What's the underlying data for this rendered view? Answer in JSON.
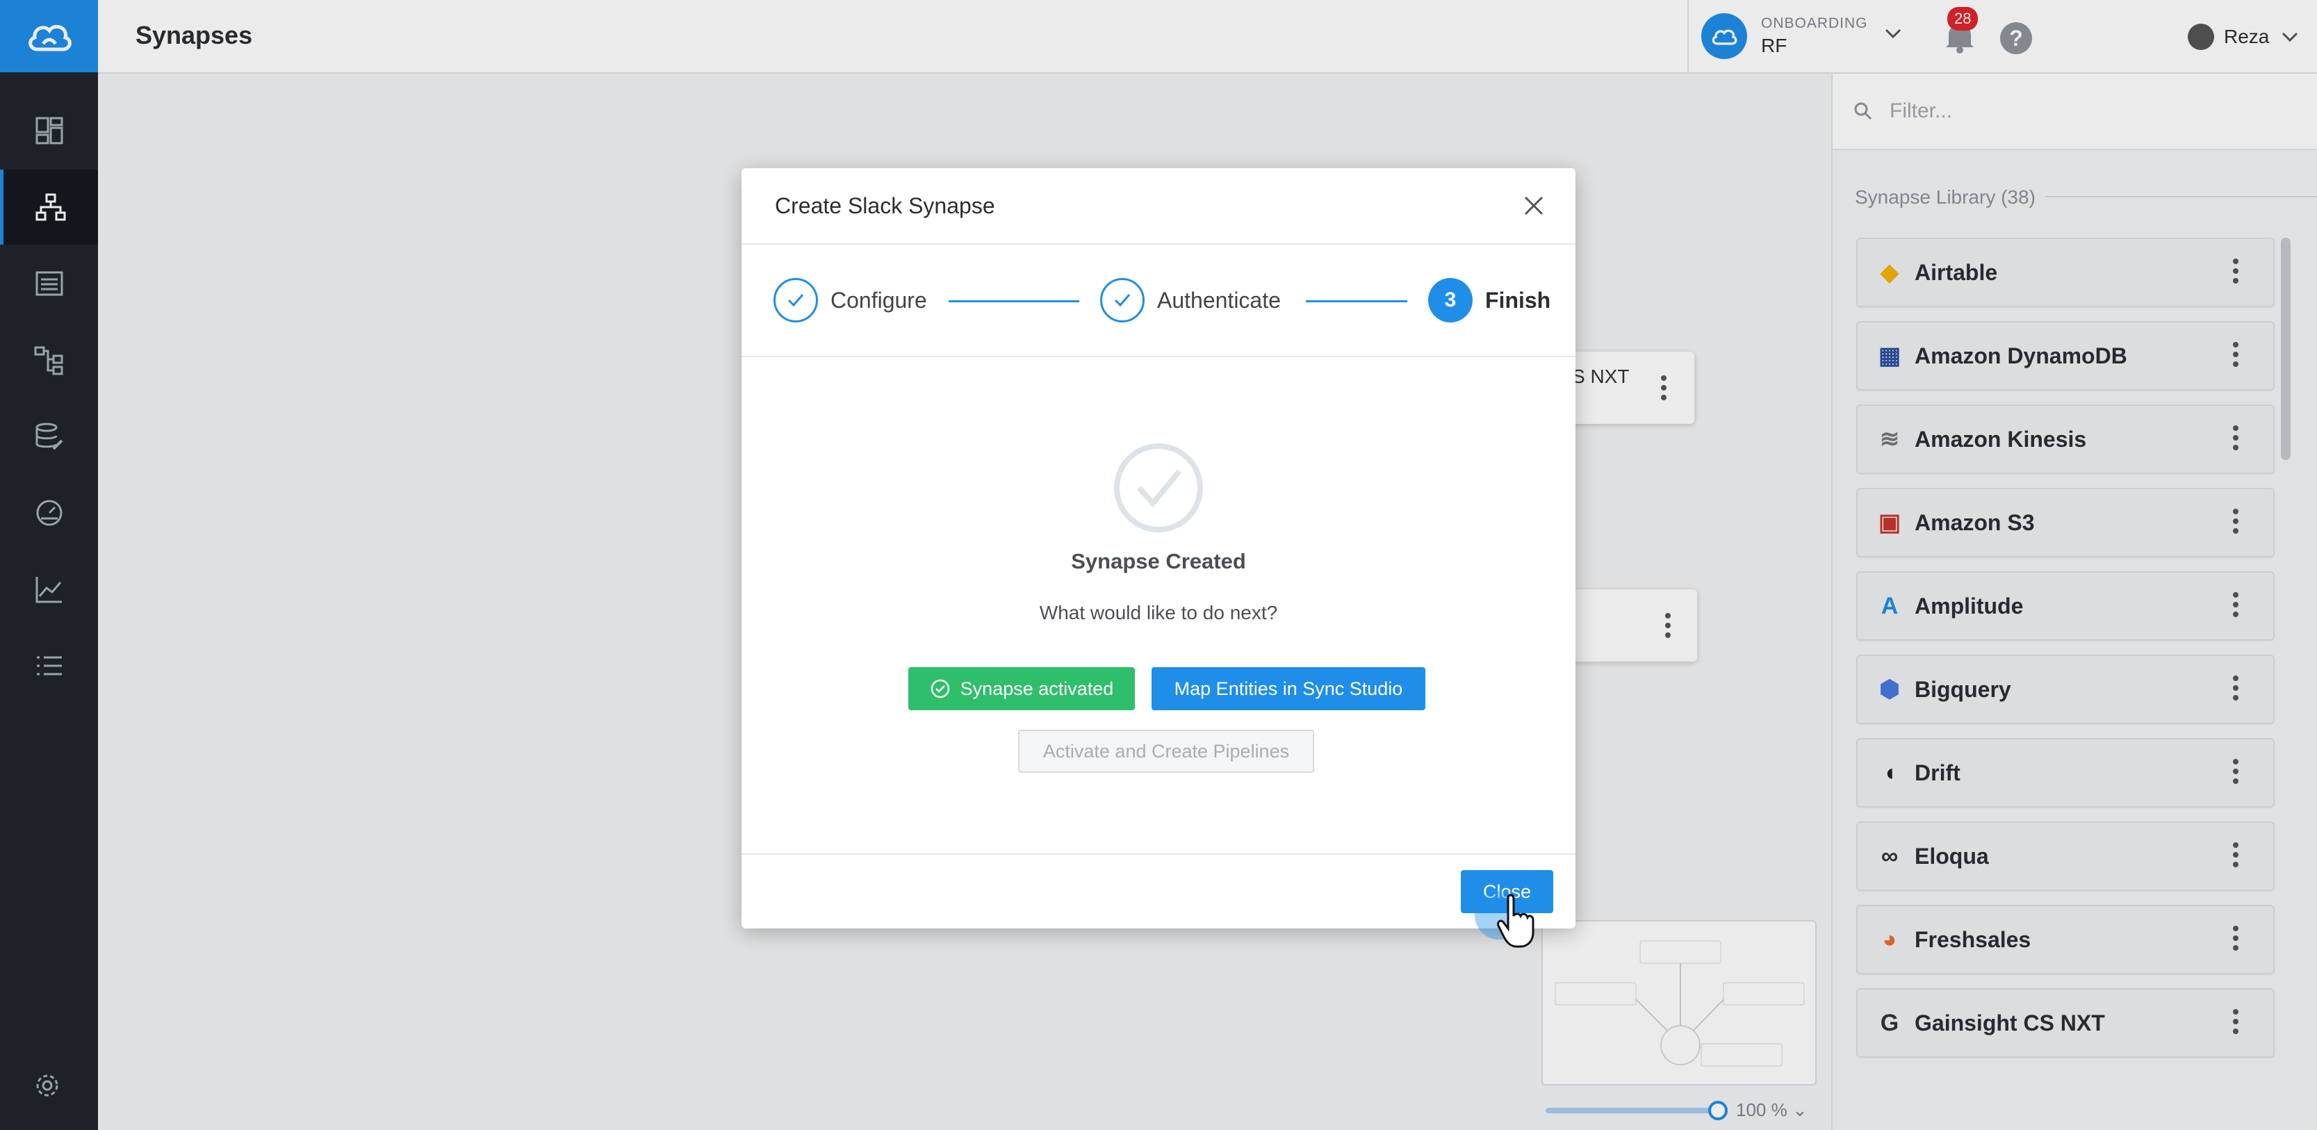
{
  "header": {
    "title": "Synapses",
    "org_label": "ONBOARDING",
    "org_name": "RF",
    "notification_count": "28",
    "help_label": "?",
    "user_name": "Reza"
  },
  "sidebar": {
    "items": [
      {
        "icon": "dashboard-icon"
      },
      {
        "icon": "synapses-icon",
        "active": true
      },
      {
        "icon": "list-icon"
      },
      {
        "icon": "pipelines-icon"
      },
      {
        "icon": "data-edit-icon"
      },
      {
        "icon": "speedometer-icon"
      },
      {
        "icon": "chart-icon"
      },
      {
        "icon": "logs-icon"
      }
    ],
    "expand_label": "»"
  },
  "canvas": {
    "node_partial_label": "S NXT",
    "zoom_label": "100 %"
  },
  "library": {
    "filter_placeholder": "Filter...",
    "title": "Synapse Library (38)",
    "items": [
      {
        "name": "Airtable",
        "color": "#f4b400"
      },
      {
        "name": "Amazon DynamoDB",
        "color": "#2b4f9e"
      },
      {
        "name": "Amazon Kinesis",
        "color": "#777777"
      },
      {
        "name": "Amazon S3",
        "color": "#c7372f"
      },
      {
        "name": "Amplitude",
        "color": "#1f8ee8"
      },
      {
        "name": "Bigquery",
        "color": "#4a78e0"
      },
      {
        "name": "Drift",
        "color": "#222222"
      },
      {
        "name": "Eloqua",
        "color": "#333333"
      },
      {
        "name": "Freshsales",
        "color": "#ef6c2a"
      },
      {
        "name": "Gainsight CS NXT",
        "color": "#333333"
      }
    ]
  },
  "modal": {
    "title": "Create Slack Synapse",
    "steps": [
      {
        "label": "Configure",
        "state": "done"
      },
      {
        "label": "Authenticate",
        "state": "done"
      },
      {
        "label": "Finish",
        "state": "active",
        "number": "3"
      }
    ],
    "success_title": "Synapse Created",
    "success_subtitle": "What would like to do next?",
    "btn_activated": "Synapse activated",
    "btn_map": "Map Entities in Sync Studio",
    "btn_activate_pipelines": "Activate and Create Pipelines",
    "btn_close": "Close"
  }
}
